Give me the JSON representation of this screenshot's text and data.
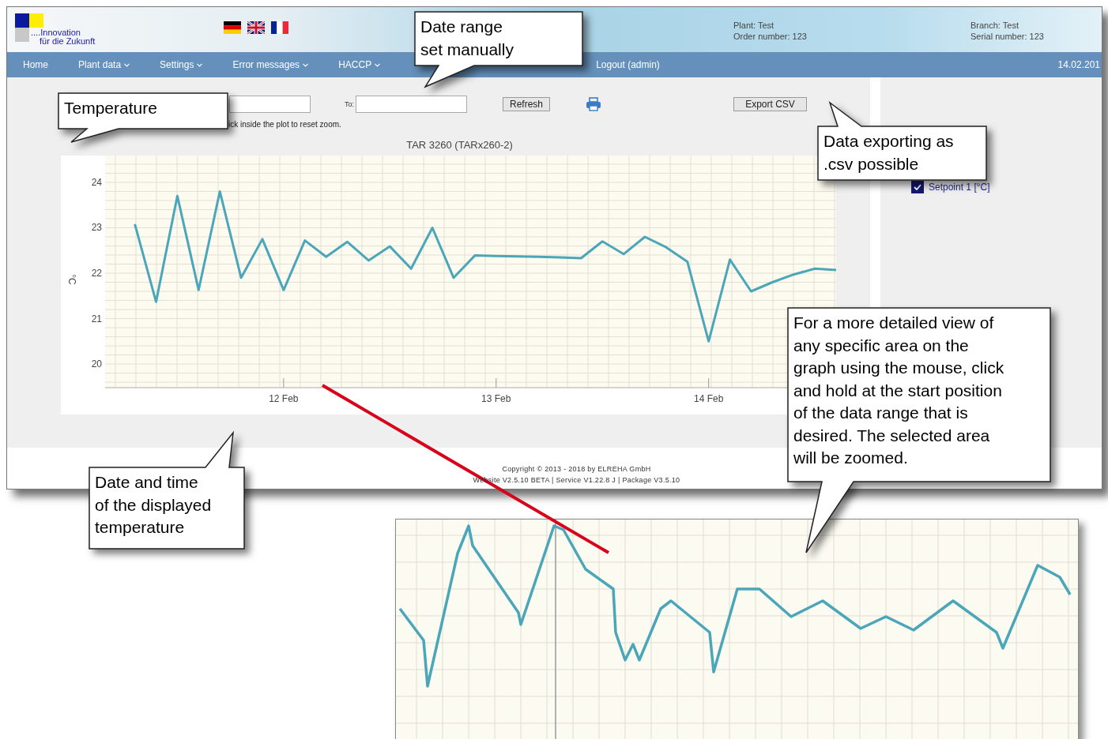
{
  "header": {
    "logo_line_1": "....Innovation",
    "logo_line_2": "für die Zukunft",
    "plant": "Plant: Test",
    "order_number": "Order number: 123",
    "branch": "Branch: Test",
    "serial_number": "Serial number: 123"
  },
  "nav": {
    "items": [
      {
        "label": "Home",
        "dropdown": false
      },
      {
        "label": "Plant data",
        "dropdown": true
      },
      {
        "label": "Settings",
        "dropdown": true
      },
      {
        "label": "Error messages",
        "dropdown": true
      },
      {
        "label": "HACCP",
        "dropdown": true
      }
    ],
    "logout": "Logout (admin)",
    "date": "14.02.201"
  },
  "filters": {
    "to_label": "To:",
    "refresh": "Refresh",
    "export": "Export CSV",
    "hint": "ick inside the plot to reset zoom."
  },
  "chart": {
    "title": "TAR 3260 (TARx260-2)",
    "chart_data": {
      "type": "line",
      "grid": true,
      "ylabel": "°C",
      "ylim": [
        19.48,
        24.59
      ],
      "yticks": [
        20,
        21,
        22,
        23,
        24
      ],
      "categories": [
        null,
        null,
        null,
        null,
        null,
        null,
        null,
        "12 Feb",
        null,
        null,
        null,
        null,
        null,
        null,
        null,
        null,
        null,
        "13 Feb",
        null,
        null,
        null,
        null,
        null,
        null,
        null,
        null,
        null,
        "14 Feb",
        null,
        null,
        null,
        null,
        null,
        null
      ],
      "series": [
        {
          "color": "#4aa6b8",
          "values": [
            23.08,
            21.37,
            23.7,
            21.63,
            23.8,
            21.9,
            22.75,
            21.63,
            22.72,
            22.36,
            22.69,
            22.28,
            22.59,
            22.1,
            23.0,
            21.9,
            22.39,
            22.38,
            22.37,
            22.36,
            22.35,
            22.33,
            22.7,
            22.42,
            22.8,
            22.57,
            22.25,
            20.5,
            22.3,
            21.6,
            21.8,
            21.97,
            22.1,
            22.07
          ]
        }
      ]
    }
  },
  "legend": [
    {
      "label": "Setpoint 1 [°C]",
      "checked": true
    }
  ],
  "footer": [
    "Copyright © 2013 - 2018 by ELREHA GmbH",
    "Website V2.5.10 BETA | Service V1.22.8 J | Package V3.5.10"
  ],
  "callouts": [
    "Temperature",
    "Date range\nset manually",
    "Data exporting as\n.csv possible",
    "Date and time\nof the displayed\ntemperature",
    "For a more detailed view of\nany specific area on the\ngraph using the mouse, click\nand hold at the start position\nof the data range that is\ndesired. The selected area\nwill be zoomed."
  ]
}
